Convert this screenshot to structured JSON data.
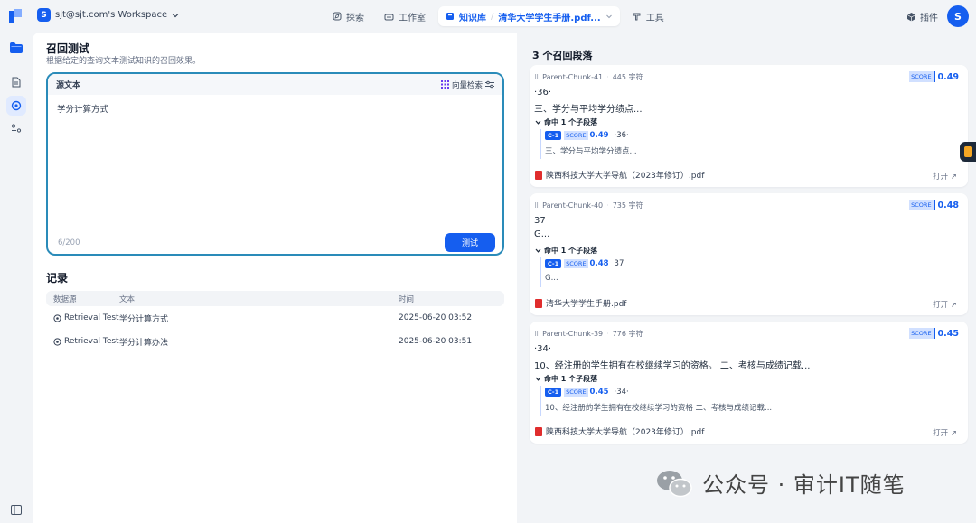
{
  "topbar": {
    "workspace_avatar": "S",
    "workspace_name": "sjt@sjt.com's Workspace",
    "nav": [
      {
        "label": "探索"
      },
      {
        "label": "工作室"
      },
      {
        "label": "知识库",
        "doc": "清华大学学生手册.pdf..."
      },
      {
        "label": "工具"
      }
    ],
    "plugin_label": "插件",
    "user_avatar": "S"
  },
  "main": {
    "title": "召回测试",
    "desc": "根据给定的查询文本测试知识的召回效果。",
    "source": {
      "label": "源文本",
      "mode": "向量检索",
      "query": "学分计算方式",
      "count": "6/200",
      "test_button": "测试"
    },
    "records": {
      "title": "记录",
      "headers": [
        "数据源",
        "文本",
        "时间"
      ],
      "rows": [
        {
          "source": "Retrieval Test",
          "text": "学分计算方式",
          "time": "2025-06-20 03:52"
        },
        {
          "source": "Retrieval Test",
          "text": "学分计算办法",
          "time": "2025-06-20 03:51"
        }
      ]
    }
  },
  "results": {
    "title": "3 个召回段落",
    "cards": [
      {
        "chunk": "Parent-Chunk-41",
        "chars": "445 字符",
        "score_label": "SCORE",
        "score": "0.49",
        "line1": "·36·",
        "line2": "三、学分与平均学分绩点...",
        "hits": "命中 1 个子段落",
        "child_tag": "C-1",
        "child_score": "0.49",
        "child_val": "·36·",
        "child_text": "三、学分与平均学分绩点...",
        "file": "陕西科技大学大学导航（2023年修订）.pdf",
        "open": "打开 ↗"
      },
      {
        "chunk": "Parent-Chunk-40",
        "chars": "735 字符",
        "score_label": "SCORE",
        "score": "0.48",
        "line1": "37",
        "line2": "G...",
        "hits": "命中 1 个子段落",
        "child_tag": "C-1",
        "child_score": "0.48",
        "child_val": "37",
        "child_text": "G...",
        "file": "清华大学学生手册.pdf",
        "open": "打开 ↗"
      },
      {
        "chunk": "Parent-Chunk-39",
        "chars": "776 字符",
        "score_label": "SCORE",
        "score": "0.45",
        "line1": "·34·",
        "line2": "10、经注册的学生拥有在校继续学习的资格。 二、考核与成绩记载...",
        "hits": "命中 1 个子段落",
        "child_tag": "C-1",
        "child_score": "0.45",
        "child_val": "·34·",
        "child_text": "10、经注册的学生拥有在校继续学习的资格 二、考核与成绩记载...",
        "file": "陕西科技大学大学导航（2023年修订）.pdf",
        "open": "打开 ↗"
      }
    ]
  },
  "watermark": "公众号 · 审计IT随笔",
  "colors": {
    "accent": "#155eef",
    "border_focus": "#2a8bb9",
    "pdf": "#e02d2d"
  }
}
